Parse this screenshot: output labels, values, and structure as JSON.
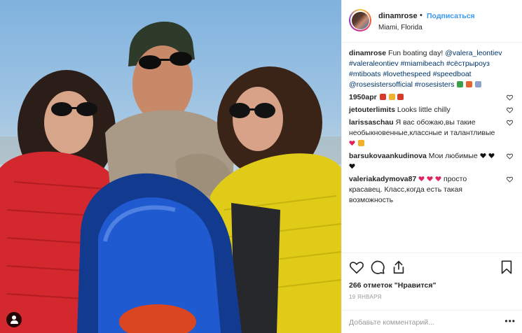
{
  "post": {
    "image_alt": "Three people on a speedboat",
    "colors": {
      "link": "#3897f0",
      "hashtag": "#003569",
      "muted": "#999999",
      "text": "#262626"
    }
  },
  "header": {
    "username": "dinamrose",
    "separator": "•",
    "follow_label": "Подписаться",
    "location": "Miami, Florida"
  },
  "caption": {
    "username": "dinamrose",
    "text": "Fun boating day!",
    "tags": [
      "@valera_leontiev",
      "#valeraleontiev",
      "#miamibeach",
      "#сёстрыроуз",
      "#mtiboats",
      "#lovethespeed",
      "#speedboat",
      "@rosesistersofficial",
      "#rosesisters"
    ],
    "emoji_icons": [
      "palm-tree-icon",
      "flag-icon",
      "speedboat-icon"
    ]
  },
  "comments": [
    {
      "username": "1950apr",
      "text": "",
      "emoji_icons": [
        "rose-icon",
        "clap-icon",
        "rose-icon"
      ]
    },
    {
      "username": "jetouterlimits",
      "text": "Looks little chilly",
      "emoji_icons": []
    },
    {
      "username": "larissaschau",
      "text": "Я вас обожаю,вы такие необыкновенные,классные и талантливые",
      "emoji_icons": [
        "heart-icon",
        "thumbs-up-icon"
      ]
    },
    {
      "username": "barsukovaankudinova",
      "text": "Мои любимые",
      "emoji_icons": [
        "black-heart-icon",
        "black-heart-icon",
        "black-heart-icon"
      ]
    },
    {
      "username": "valeriakadymova87",
      "text": "просто красавец. Класс,когда есть такая возможность",
      "emoji_icons": [
        "heart-icon",
        "heart-icon",
        "heart-icon"
      ]
    }
  ],
  "actions": {
    "likes": "266 отметок \"Нравится\"",
    "date": "19 ЯНВАРЯ",
    "comment_placeholder": "Добавьте комментарий...",
    "more": "•••"
  }
}
